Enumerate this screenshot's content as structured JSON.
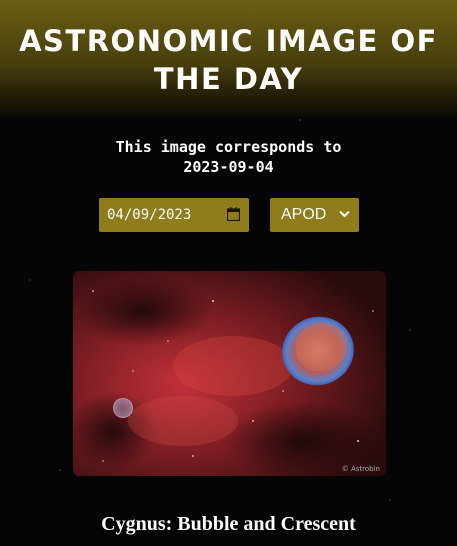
{
  "header": {
    "title": "ASTRONOMIC IMAGE OF THE DAY"
  },
  "info": {
    "corresponds_line1": "This image corresponds to",
    "corresponds_date": "2023-09-04"
  },
  "controls": {
    "date_value": "04/09/2023",
    "source_selected": "APOD",
    "calendar_icon": "calendar-icon",
    "chevron_icon": "chevron-down-icon"
  },
  "image": {
    "credit_watermark": "© Astrobin",
    "title": "Cygnus: Bubble and Crescent"
  },
  "colors": {
    "accent": "#8f7d1c",
    "header_top": "#6b5e14",
    "background": "#050505"
  }
}
